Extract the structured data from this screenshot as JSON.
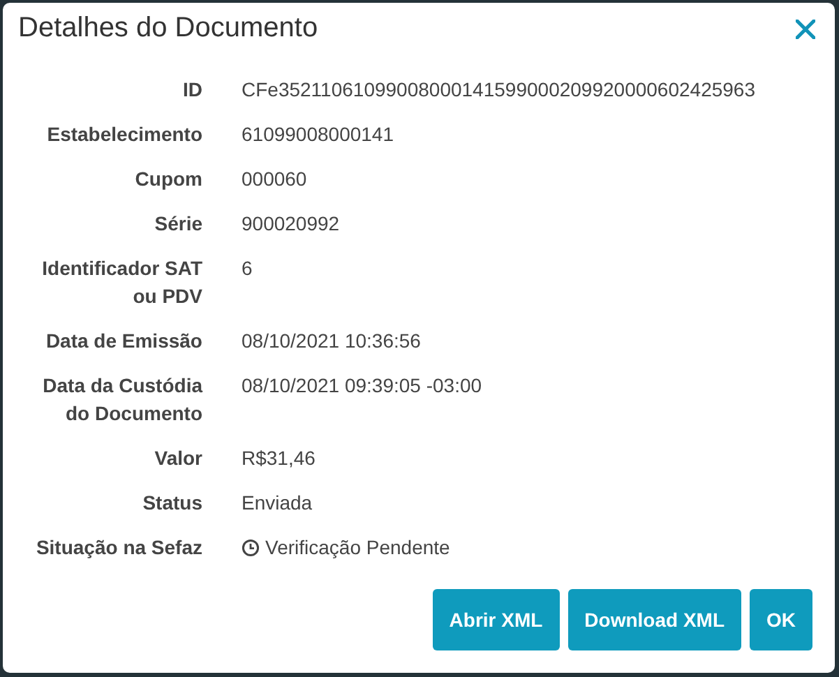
{
  "dialog": {
    "title": "Detalhes do Documento",
    "fields": [
      {
        "label": "ID",
        "value": "CFe35211061099008000141599000209920000602425963",
        "kind": "text"
      },
      {
        "label": "Estabelecimento",
        "value": "61099008000141",
        "kind": "text"
      },
      {
        "label": "Cupom",
        "value": "000060",
        "kind": "text"
      },
      {
        "label": "Série",
        "value": "900020992",
        "kind": "text"
      },
      {
        "label": "Identificador SAT ou PDV",
        "value": "6",
        "kind": "text"
      },
      {
        "label": "Data de Emissão",
        "value": "08/10/2021 10:36:56",
        "kind": "text"
      },
      {
        "label": "Data da Custódia do Documento",
        "value": "08/10/2021 09:39:05 -03:00",
        "kind": "text"
      },
      {
        "label": "Valor",
        "value": "R$31,46",
        "kind": "text"
      },
      {
        "label": "Status",
        "value": "Enviada",
        "kind": "text"
      },
      {
        "label": "Situação na Sefaz",
        "value": "Verificação Pendente",
        "kind": "pending"
      }
    ],
    "buttons": [
      "Abrir XML",
      "Download XML",
      "OK"
    ]
  }
}
